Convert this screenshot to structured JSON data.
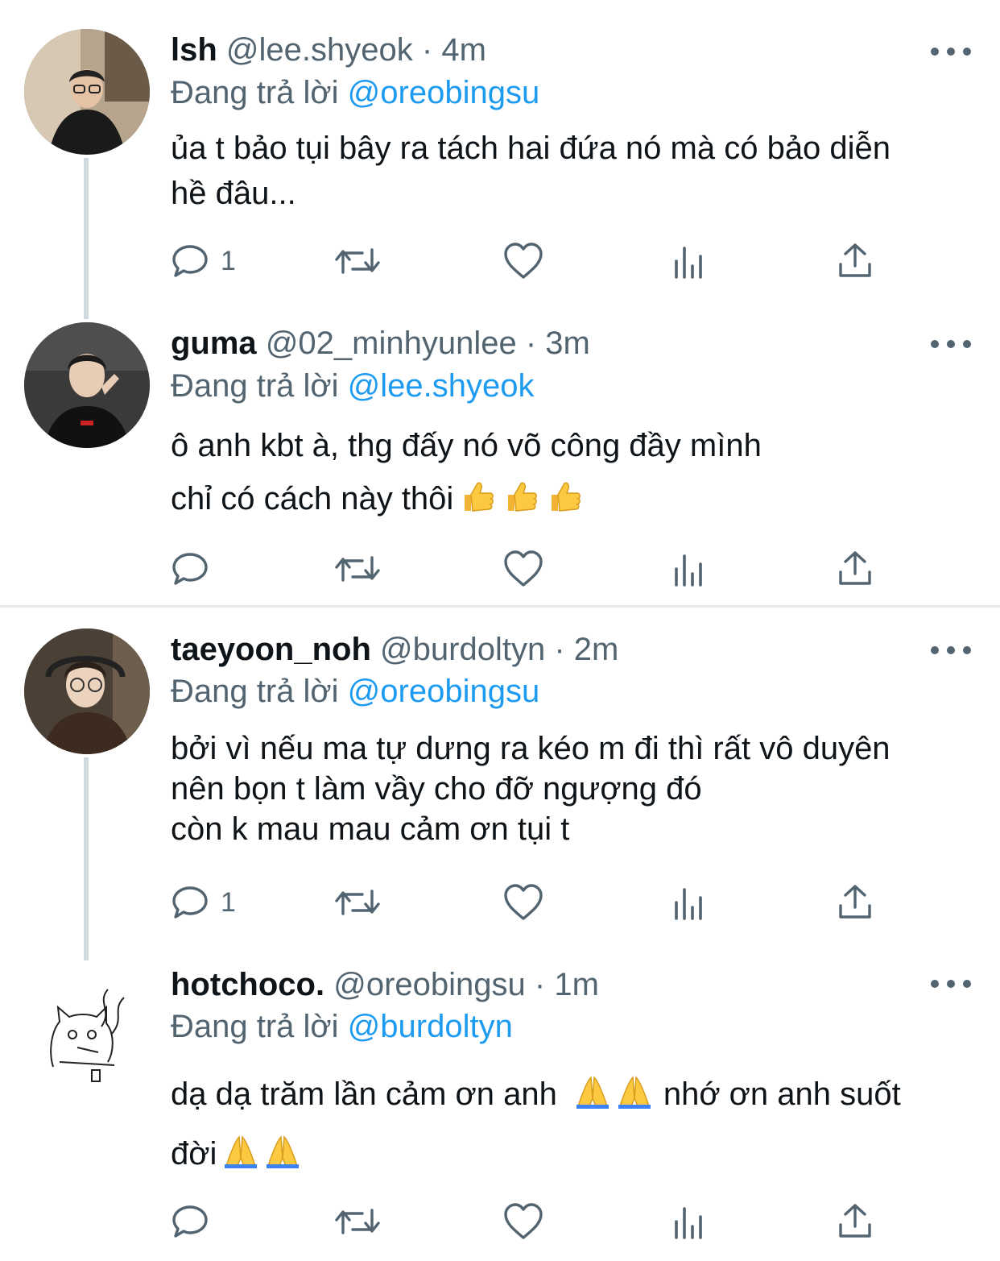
{
  "tweets": [
    {
      "name": "lsh",
      "handle": "@lee.shyeok",
      "time": "· 4m",
      "reply_prefix": "Đang trả lời",
      "reply_to": "@oreobingsu",
      "text_lines": [
        "ủa t bảo tụi bây ra tách hai đứa nó mà có bảo diễn",
        "hề đâu..."
      ],
      "reply_count": "1"
    },
    {
      "name": "guma",
      "handle": "@02_minhyunlee",
      "time": "· 3m",
      "reply_prefix": "Đang trả lời",
      "reply_to": "@lee.shyeok",
      "text_lines": [
        "ô anh kbt à, thg đấy nó võ công đầy mình",
        "chỉ có cách này thôi"
      ],
      "emoji": "thumbs-up-icon ×3",
      "reply_count": ""
    },
    {
      "name": "taeyoon_noh",
      "handle": "@burdoltyn",
      "time": "· 2m",
      "reply_prefix": "Đang trả lời",
      "reply_to": "@oreobingsu",
      "text_lines": [
        "bởi vì nếu ma tự dưng ra kéo m đi thì rất vô duyên",
        "nên bọn t làm vầy cho đỡ ngượng đó",
        "còn k mau mau cảm ơn tụi t"
      ],
      "reply_count": "1"
    },
    {
      "name": "hotchoco.",
      "handle": "@oreobingsu",
      "time": "· 1m",
      "reply_prefix": "Đang trả lời",
      "reply_to": "@burdoltyn",
      "text_lines": [
        "dạ dạ trăm lần cảm ơn anh",
        "nhớ ơn anh suốt",
        "đời"
      ],
      "emoji": "folded-hands-icon",
      "reply_count": ""
    }
  ],
  "colors": {
    "accent": "#1d9bf0",
    "muted": "#536471",
    "text": "#0f1419",
    "thread_line": "#cfd9de"
  }
}
